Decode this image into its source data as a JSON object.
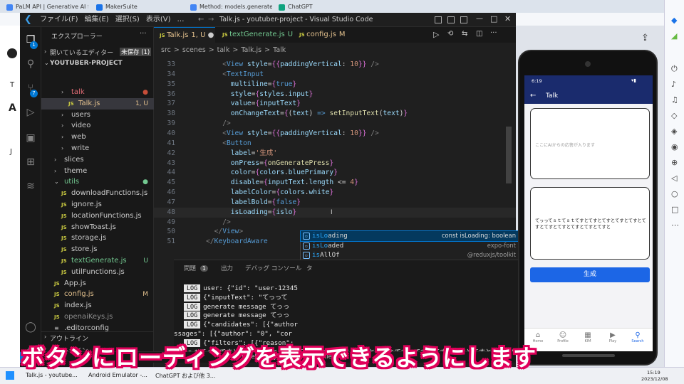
{
  "browser": {
    "tabs": [
      {
        "label": "PaLM API | Generative AI for De",
        "color": "#4285f4"
      },
      {
        "label": "MakerSuite",
        "color": "#1a73e8"
      },
      {
        "label": "Method: models.generateMessa",
        "color": "#4285f4"
      },
      {
        "label": "ChatGPT",
        "color": "#10a37f"
      }
    ]
  },
  "vscode": {
    "menu": [
      "ファイル(F)",
      "編集(E)",
      "選択(S)",
      "表示(V)",
      "…"
    ],
    "title": "Talk.js - youtuber-project - Visual Studio Code",
    "explorer_header": "エクスプローラー",
    "open_editors": "開いているエディター",
    "unsaved": "未保存 (1)",
    "project": "YOUTUBER-PROJECT",
    "tree": [
      {
        "label": "talk",
        "kind": "folder",
        "indent": 2,
        "color": "#e06c75",
        "status": "●",
        "status_color": "#c74e39"
      },
      {
        "label": "Talk.js",
        "kind": "js",
        "indent": 3,
        "color": "#e2c08d",
        "status": "1, U",
        "status_color": "#e2c08d",
        "selected": true
      },
      {
        "label": "users",
        "kind": "folder",
        "indent": 2,
        "color": "#ccc"
      },
      {
        "label": "video",
        "kind": "folder",
        "indent": 2,
        "color": "#ccc"
      },
      {
        "label": "web",
        "kind": "folder",
        "indent": 2,
        "color": "#ccc"
      },
      {
        "label": "write",
        "kind": "folder",
        "indent": 2,
        "color": "#ccc"
      },
      {
        "label": "slices",
        "kind": "folder",
        "indent": 1,
        "color": "#ccc"
      },
      {
        "label": "theme",
        "kind": "folder",
        "indent": 1,
        "color": "#ccc"
      },
      {
        "label": "utils",
        "kind": "folder-open",
        "indent": 1,
        "color": "#73c991",
        "status": "●",
        "status_color": "#73c991"
      },
      {
        "label": "downloadFunctions.js",
        "kind": "js",
        "indent": 2,
        "color": "#ccc"
      },
      {
        "label": "ignore.js",
        "kind": "js",
        "indent": 2,
        "color": "#ccc"
      },
      {
        "label": "locationFunctions.js",
        "kind": "js",
        "indent": 2,
        "color": "#ccc"
      },
      {
        "label": "showToast.js",
        "kind": "js",
        "indent": 2,
        "color": "#ccc"
      },
      {
        "label": "storage.js",
        "kind": "js",
        "indent": 2,
        "color": "#ccc"
      },
      {
        "label": "store.js",
        "kind": "js",
        "indent": 2,
        "color": "#ccc"
      },
      {
        "label": "textGenerate.js",
        "kind": "js",
        "indent": 2,
        "color": "#73c991",
        "status": "U",
        "status_color": "#73c991"
      },
      {
        "label": "utilFunctions.js",
        "kind": "js",
        "indent": 2,
        "color": "#ccc"
      },
      {
        "label": "App.js",
        "kind": "js",
        "indent": 1,
        "color": "#ccc"
      },
      {
        "label": "config.js",
        "kind": "js",
        "indent": 1,
        "color": "#e2c08d",
        "status": "M",
        "status_color": "#e2c08d"
      },
      {
        "label": "index.js",
        "kind": "js",
        "indent": 1,
        "color": "#ccc"
      },
      {
        "label": "openaiKeys.js",
        "kind": "js",
        "indent": 1,
        "color": "#8c8c8c"
      },
      {
        "label": ".editorconfig",
        "kind": "cfg",
        "indent": 1,
        "color": "#ccc"
      }
    ],
    "outline": "アウトライン",
    "timeline": "タイムライン",
    "tabs": [
      {
        "label": "Talk.js",
        "suffix": "1, U",
        "color": "#e2c08d",
        "active": true
      },
      {
        "label": "textGenerate.js",
        "suffix": "U",
        "color": "#73c991"
      },
      {
        "label": "config.js",
        "suffix": "M",
        "color": "#e2c08d"
      }
    ],
    "breadcrumb": [
      "src",
      ">",
      "scenes",
      ">",
      "talk",
      ">",
      "Talk.js",
      ">",
      "Talk"
    ],
    "lines": [
      {
        "n": "33",
        "t": [
          [
            "p",
            "        "
          ],
          [
            "g",
            "<"
          ],
          [
            "k",
            "View "
          ],
          [
            "a",
            "style"
          ],
          [
            "p",
            "="
          ],
          [
            "b",
            "{{"
          ],
          [
            "a",
            "paddingVertical"
          ],
          [
            "p",
            ": "
          ],
          [
            "s",
            "10"
          ],
          [
            "b",
            "}}"
          ],
          [
            "g",
            " />"
          ]
        ]
      },
      {
        "n": "34",
        "t": [
          [
            "p",
            "        "
          ],
          [
            "g",
            "<"
          ],
          [
            "k",
            "TextInput"
          ]
        ]
      },
      {
        "n": "35",
        "t": [
          [
            "p",
            "          "
          ],
          [
            "a",
            "multiline"
          ],
          [
            "p",
            "="
          ],
          [
            "b",
            "{"
          ],
          [
            "k",
            "true"
          ],
          [
            "b",
            "}"
          ]
        ]
      },
      {
        "n": "36",
        "t": [
          [
            "p",
            "          "
          ],
          [
            "a",
            "style"
          ],
          [
            "p",
            "="
          ],
          [
            "b",
            "{"
          ],
          [
            "a",
            "styles"
          ],
          [
            "p",
            "."
          ],
          [
            "a",
            "input"
          ],
          [
            "b",
            "}"
          ]
        ]
      },
      {
        "n": "37",
        "t": [
          [
            "p",
            "          "
          ],
          [
            "a",
            "value"
          ],
          [
            "p",
            "="
          ],
          [
            "b",
            "{"
          ],
          [
            "a",
            "inputText"
          ],
          [
            "b",
            "}"
          ]
        ]
      },
      {
        "n": "38",
        "t": [
          [
            "p",
            "          "
          ],
          [
            "a",
            "onChangeText"
          ],
          [
            "p",
            "="
          ],
          [
            "b",
            "{"
          ],
          [
            "p",
            "("
          ],
          [
            "a",
            "text"
          ],
          [
            "p",
            ") "
          ],
          [
            "k",
            "=>"
          ],
          [
            "p",
            " "
          ],
          [
            "f",
            "setInputText"
          ],
          [
            "p",
            "("
          ],
          [
            "a",
            "text"
          ],
          [
            "p",
            ")"
          ],
          [
            "b",
            "}"
          ]
        ]
      },
      {
        "n": "39",
        "t": [
          [
            "p",
            "        "
          ],
          [
            "g",
            "/>"
          ]
        ]
      },
      {
        "n": "40",
        "t": [
          [
            "p",
            "        "
          ],
          [
            "g",
            "<"
          ],
          [
            "k",
            "View "
          ],
          [
            "a",
            "style"
          ],
          [
            "p",
            "="
          ],
          [
            "b",
            "{{"
          ],
          [
            "a",
            "paddingVertical"
          ],
          [
            "p",
            ": "
          ],
          [
            "s",
            "10"
          ],
          [
            "b",
            "}}"
          ],
          [
            "g",
            " />"
          ]
        ]
      },
      {
        "n": "41",
        "t": [
          [
            "p",
            "        "
          ],
          [
            "g",
            "<"
          ],
          [
            "k",
            "Button"
          ]
        ]
      },
      {
        "n": "42",
        "t": [
          [
            "p",
            "          "
          ],
          [
            "a",
            "label"
          ],
          [
            "p",
            "="
          ],
          [
            "s",
            "'生成'"
          ]
        ]
      },
      {
        "n": "43",
        "t": [
          [
            "p",
            "          "
          ],
          [
            "a",
            "onPress"
          ],
          [
            "p",
            "="
          ],
          [
            "b",
            "{"
          ],
          [
            "f",
            "onGeneratePress"
          ],
          [
            "b",
            "}"
          ]
        ]
      },
      {
        "n": "44",
        "t": [
          [
            "p",
            "          "
          ],
          [
            "a",
            "color"
          ],
          [
            "p",
            "="
          ],
          [
            "b",
            "{"
          ],
          [
            "a",
            "colors"
          ],
          [
            "p",
            "."
          ],
          [
            "a",
            "bluePrimary"
          ],
          [
            "b",
            "}"
          ]
        ]
      },
      {
        "n": "45",
        "t": [
          [
            "p",
            "          "
          ],
          [
            "a",
            "disable"
          ],
          [
            "p",
            "="
          ],
          [
            "b",
            "{"
          ],
          [
            "a",
            "inputText"
          ],
          [
            "p",
            "."
          ],
          [
            "a",
            "length"
          ],
          [
            "p",
            " <= "
          ],
          [
            "s",
            "4"
          ],
          [
            "b",
            "}"
          ]
        ]
      },
      {
        "n": "46",
        "t": [
          [
            "p",
            "          "
          ],
          [
            "a",
            "labelColor"
          ],
          [
            "p",
            "="
          ],
          [
            "b",
            "{"
          ],
          [
            "a",
            "colors"
          ],
          [
            "p",
            "."
          ],
          [
            "a",
            "white"
          ],
          [
            "b",
            "}"
          ]
        ]
      },
      {
        "n": "47",
        "t": [
          [
            "p",
            "          "
          ],
          [
            "a",
            "labelBold"
          ],
          [
            "p",
            "="
          ],
          [
            "b",
            "{"
          ],
          [
            "k",
            "false"
          ],
          [
            "b",
            "}"
          ]
        ]
      },
      {
        "n": "48",
        "t": [
          [
            "p",
            "          "
          ],
          [
            "a",
            "isLoading"
          ],
          [
            "p",
            "="
          ],
          [
            "b",
            "{"
          ],
          [
            "a",
            "islo"
          ],
          [
            "b",
            "}"
          ]
        ]
      },
      {
        "n": "49",
        "t": [
          [
            "p",
            "        "
          ],
          [
            "g",
            "/>"
          ]
        ]
      },
      {
        "n": "50",
        "t": [
          [
            "p",
            "      "
          ],
          [
            "g",
            "</"
          ],
          [
            "k",
            "View"
          ],
          [
            "g",
            ">"
          ]
        ]
      },
      {
        "n": "51",
        "t": [
          [
            "p",
            "    "
          ],
          [
            "g",
            "</"
          ],
          [
            "k",
            "KeyboardAware"
          ]
        ]
      }
    ],
    "suggest": [
      {
        "name": "isLoading",
        "hl": "isLo",
        "detail": "const isLoading: boolean",
        "sel": true
      },
      {
        "name": "isLoaded",
        "hl": "isLo",
        "detail": "expo-font"
      },
      {
        "name": "isAllOf",
        "hl": "is",
        "detail": "@reduxjs/toolkit"
      },
      {
        "name": "isBlobLike",
        "hl": "is",
        "detail": "openai/uploads"
      },
      {
        "name": "isColor",
        "hl": "is",
        "detail": "react-native-reanimated"
      },
      {
        "name": "isUploadable",
        "hl": "is",
        "detail": "openai/uploads"
      },
      {
        "name": "isPlainObject",
        "hl": "is",
        "detail": "@reduxjs/toolkit"
      },
      {
        "name": "isBackgroundLocationAvailableAsync",
        "hl": "is",
        "detail": "expo-location"
      },
      {
        "name": "setIsLoading",
        "hl": "",
        "detail": ""
      },
      {
        "name": "isResponseLike",
        "hl": "is",
        "detail": "openai/uploads"
      },
      {
        "name": "isValidIcon",
        "hl": "is",
        "detail": "react-native-paper/lib/typescript/compone…"
      },
      {
        "name": "isDomElement",
        "hl": "is",
        "detail": "react-native-render-html"
      }
    ],
    "panel_tabs": [
      {
        "label": "問題",
        "badge": "1"
      },
      {
        "label": "出力"
      },
      {
        "label": "デバッグ コンソール"
      },
      {
        "label": "タ"
      }
    ],
    "logs": [
      {
        "tag": "LOG",
        "text": "user: {\"id\": \"user-12345"
      },
      {
        "tag": "LOG",
        "text": "{\"inputText\": \"てっって"
      },
      {
        "tag": "LOG",
        "text": "generate message てっっ"
      },
      {
        "tag": "LOG",
        "text": "generate message てっっ"
      },
      {
        "tag": "LOG",
        "text": "{\"candidates\": [{\"author"
      },
      {
        "tag": "",
        "text": "ssages\": [{\"author\": \"0\", \"cor"
      },
      {
        "tag": "LOG",
        "text": "{\"filters\": [{\"reason\":"
      },
      {
        "tag": "",
        "text": "ってｓｔてｓｔてすとてすとてすとてすとてすとてすとてすとてすとてすとてすとてすとてすとてすとてすとてすと\"}]}"
      }
    ],
    "status": [
      "TypeScript JSX",
      "Prettier"
    ]
  },
  "phone": {
    "time": "6:19",
    "title": "Talk",
    "back": "←",
    "placeholder": "ここにAIからの応答が入ります",
    "input_text": "てっってｓｔてｓｔてすとてすとてすとてすとてすとてすとてすとてすとてすとてすとてすと",
    "button": "生成",
    "nav": [
      {
        "icon": "⌂",
        "label": "Home"
      },
      {
        "icon": "☺",
        "label": "Profile"
      },
      {
        "icon": "▦",
        "label": "KIM"
      },
      {
        "icon": "▶",
        "label": "Play"
      },
      {
        "icon": "⚲",
        "label": "Search"
      }
    ]
  },
  "taskbar": {
    "items": [
      "Talk.js - youtube...",
      "Android Emulator -...",
      "ChatGPT および他 3..."
    ],
    "time": "15:19",
    "date": "2023/12/08"
  },
  "caption": "ボタンにローディングを表示できるようにします"
}
